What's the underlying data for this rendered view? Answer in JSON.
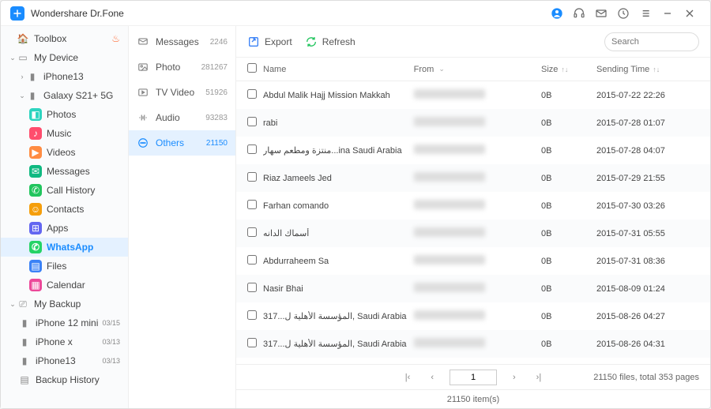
{
  "app": {
    "title": "Wondershare Dr.Fone"
  },
  "sidebar": {
    "toolbox": "Toolbox",
    "mydevice": "My Device",
    "iphone13": "iPhone13",
    "galaxy": "Galaxy S21+ 5G",
    "photos": "Photos",
    "music": "Music",
    "videos": "Videos",
    "messages": "Messages",
    "callhistory": "Call History",
    "contacts": "Contacts",
    "apps": "Apps",
    "whatsapp": "WhatsApp",
    "files": "Files",
    "calendar": "Calendar",
    "mybackup": "My Backup",
    "iphone12mini": "iPhone 12 mini",
    "iphone12mini_badge": "03/15",
    "iphonex": "iPhone x",
    "iphonex_badge": "03/13",
    "iphone13b": "iPhone13",
    "iphone13b_badge": "03/13",
    "backuphistory": "Backup History"
  },
  "categories": [
    {
      "label": "Messages",
      "count": "2246"
    },
    {
      "label": "Photo",
      "count": "281267"
    },
    {
      "label": "TV Video",
      "count": "51926"
    },
    {
      "label": "Audio",
      "count": "93283"
    },
    {
      "label": "Others",
      "count": "21150"
    }
  ],
  "toolbar": {
    "export": "Export",
    "refresh": "Refresh",
    "search_placeholder": "Search"
  },
  "columns": {
    "name": "Name",
    "from": "From",
    "size": "Size",
    "time": "Sending Time"
  },
  "rows": [
    {
      "name": "Abdul Malik Hajj Mission Makkah",
      "size": "0B",
      "time": "2015-07-22 22:26"
    },
    {
      "name": "rabi",
      "size": "0B",
      "time": "2015-07-28 01:07"
    },
    {
      "name": "منتزة ومطعم سهار...ina Saudi Arabia",
      "size": "0B",
      "time": "2015-07-28 04:07"
    },
    {
      "name": "Riaz Jameels Jed",
      "size": "0B",
      "time": "2015-07-29 21:55"
    },
    {
      "name": "Farhan comando",
      "size": "0B",
      "time": "2015-07-30 03:26"
    },
    {
      "name": "أسماك الدانه",
      "size": "0B",
      "time": "2015-07-31 05:55"
    },
    {
      "name": "Abdurraheem Sa",
      "size": "0B",
      "time": "2015-07-31 08:36"
    },
    {
      "name": "Nasir Bhai",
      "size": "0B",
      "time": "2015-08-09 01:24"
    },
    {
      "name": "317...المؤسسة الأهلية ل, Saudi Arabia",
      "size": "0B",
      "time": "2015-08-26 04:27"
    },
    {
      "name": "317...المؤسسة الأهلية ل, Saudi Arabia",
      "size": "0B",
      "time": "2015-08-26 04:31"
    }
  ],
  "pager": {
    "page": "1",
    "summary": "21150 files, total 353 pages"
  },
  "footer": {
    "items": "21150  item(s)"
  }
}
